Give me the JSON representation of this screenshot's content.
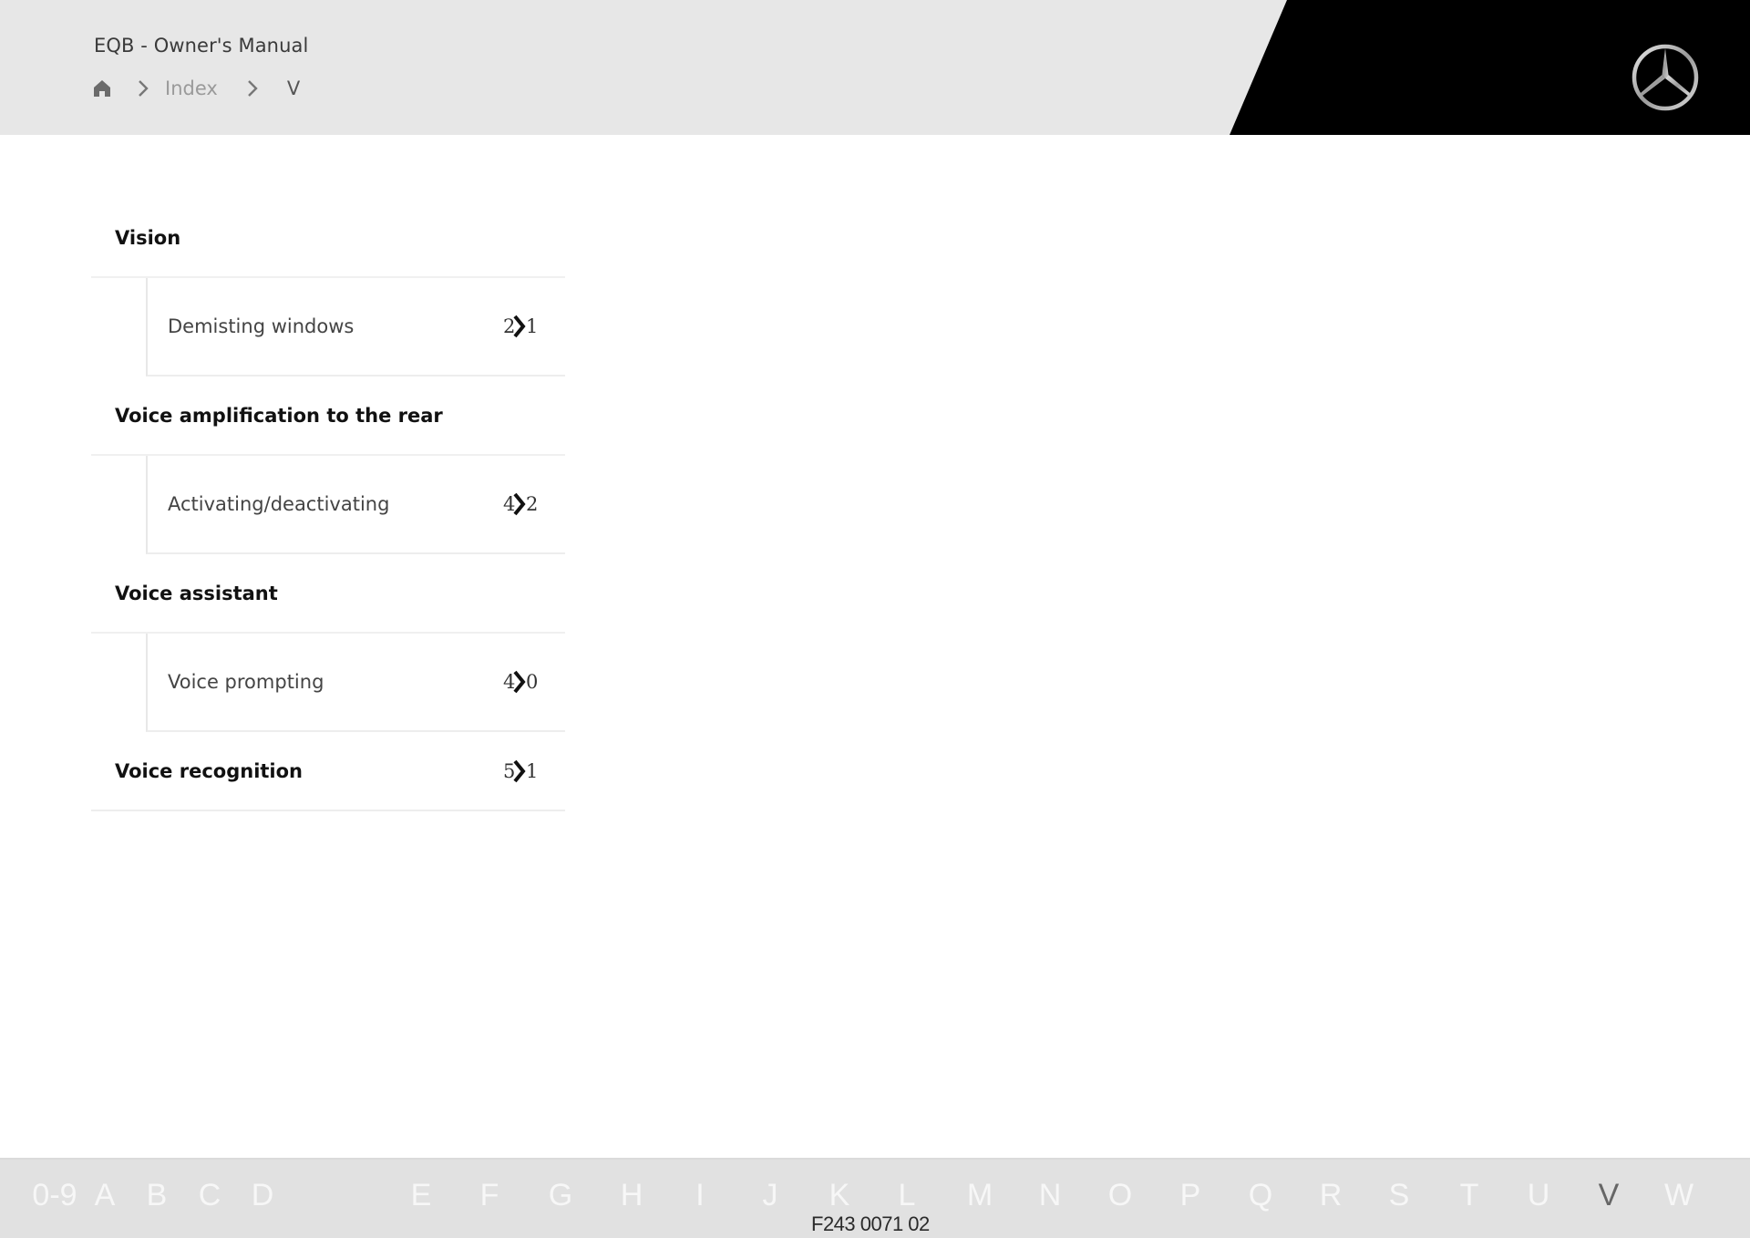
{
  "header": {
    "title": "EQB - Owner's Manual",
    "breadcrumb": {
      "home_icon": "home-icon",
      "separator_icon": "chevron-right-icon",
      "items": [
        {
          "label": "Index"
        },
        {
          "label": "V"
        }
      ]
    },
    "logo": "mercedes-benz-star-logo"
  },
  "index": {
    "groups": [
      {
        "title": "Vision",
        "children": [
          {
            "label": "Demisting windows",
            "page_visible": {
              "first": "2",
              "last": "1"
            }
          }
        ]
      },
      {
        "title": "Voice amplification to the rear",
        "children": [
          {
            "label": "Activating/deactivating",
            "page_visible": {
              "first": "4",
              "last": "2"
            }
          }
        ]
      },
      {
        "title": "Voice assistant",
        "children": [
          {
            "label": "Voice prompting",
            "page_visible": {
              "first": "4",
              "last": "0"
            }
          }
        ]
      },
      {
        "title": "Voice recognition",
        "page_visible": {
          "first": "5",
          "last": "1"
        },
        "children": []
      }
    ],
    "page_link_icon": "chevron-right-icon"
  },
  "footer": {
    "letters": [
      "0-9",
      "A",
      "B",
      "C",
      "D",
      "E",
      "F",
      "G",
      "H",
      "I",
      "J",
      "K",
      "L",
      "M",
      "N",
      "O",
      "P",
      "Q",
      "R",
      "S",
      "T",
      "U",
      "V",
      "W"
    ],
    "active_letter": "V",
    "code": "F243 0071 02"
  },
  "colors": {
    "header_bg": "#e7e7e7",
    "header_accent": "#000000",
    "footer_bg": "#e1e1e1",
    "active_letter": "#666666",
    "inactive_letter": "#f7f7f7"
  }
}
